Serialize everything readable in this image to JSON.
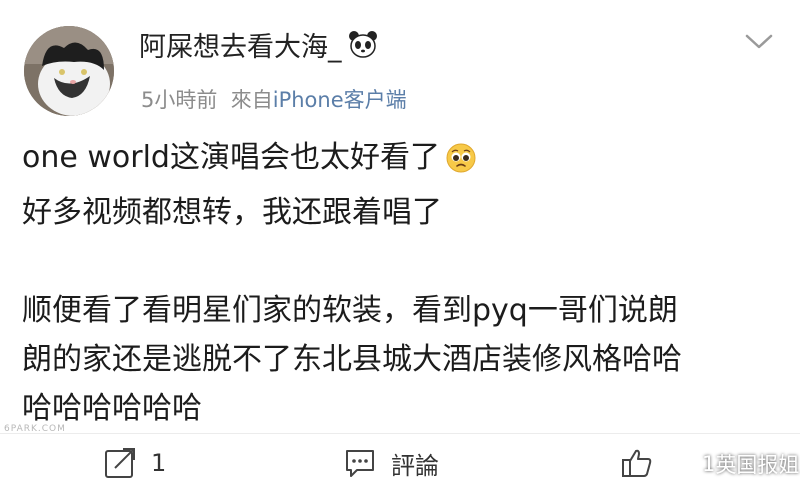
{
  "post": {
    "username": "阿屎想去看大海_",
    "time": "5小時前",
    "source_prefix": "來自",
    "source_name": "iPhone客户端",
    "lines": [
      "one world这演唱会也太好看了",
      "好多视频都想转，我还跟着唱了",
      "",
      "顺便看了看明星们家的软装，看到pyq一哥们说朗",
      "朗的家还是逃脱不了东北县城大酒店装修风格哈哈",
      "哈哈哈哈哈哈"
    ]
  },
  "actions": {
    "repost_count": "1",
    "comment_label": "評論",
    "like_count": "1"
  },
  "watermark": {
    "text": "6PARK.COM"
  },
  "overlay": {
    "wechat_label": "英国报姐"
  },
  "icons": [
    "avatar-cat",
    "panda-emoji",
    "chevron-down-icon",
    "pleading-face-emoji",
    "repost-icon",
    "comment-icon",
    "thumbs-up-icon",
    "wechat-icon"
  ]
}
